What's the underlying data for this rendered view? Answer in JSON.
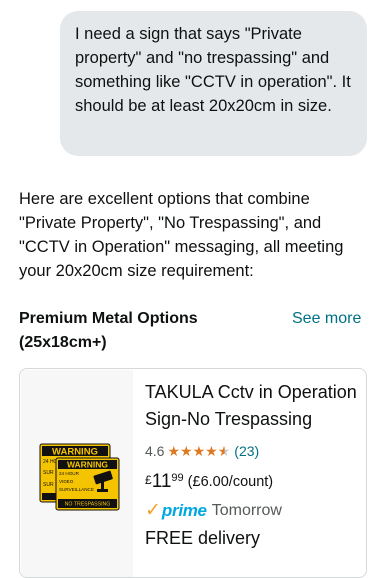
{
  "user_message": {
    "text": "I need a sign that says \"Private property\" and \"no trespassing\" and something like \"CCTV in operation\". It should be at least 20x20cm in size."
  },
  "assistant_message": {
    "text": "Here are excellent options that combine \"Private Property\", \"No Trespassing\", and \"CCTV in Operation\" messaging, all meeting your 20x20cm size requirement:"
  },
  "section": {
    "title": "Premium Metal Options (25x18cm+)",
    "see_more": "See more"
  },
  "product": {
    "title": "TAKULA Cctv in Operation Sign-No Trespassing",
    "rating": "4.6",
    "stars": 4.6,
    "rating_count": "(23)",
    "price_currency": "£",
    "price_whole": "11",
    "price_fraction": "99",
    "unit_price": "(£6.00/count)",
    "prime_label": "prime",
    "prime_delivery_day": "Tomorrow",
    "delivery_text": "FREE delivery",
    "image_sign": {
      "back_header": "WARNING",
      "back_lines": [
        "24 HOUR",
        "SUR",
        "SUR"
      ],
      "front_header": "WARNING",
      "front_lines": [
        "24 HOUR",
        "VIDEO",
        "SURVEILLANCE"
      ],
      "front_footer": "NO TRESPASSING",
      "colors": {
        "yellow": "#f5c400",
        "black": "#111111"
      }
    }
  },
  "colors": {
    "link": "#007185",
    "star": "#de7921",
    "prime": "#00a8e1",
    "prime_check": "#f4a223",
    "bubble": "#e5e8eb"
  }
}
